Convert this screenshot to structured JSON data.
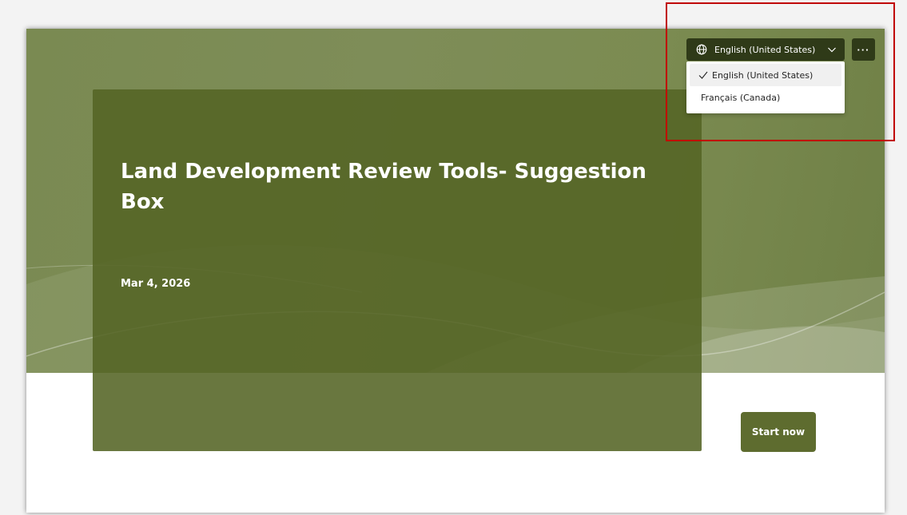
{
  "form": {
    "title": "Land Development Review Tools- Suggestion Box",
    "date": "Mar 4, 2026",
    "start_label": "Start now"
  },
  "language": {
    "current": "English (United States)",
    "options": [
      {
        "label": "English (United States)",
        "selected": true
      },
      {
        "label": "Français (Canada)",
        "selected": false
      }
    ]
  },
  "more": {
    "label": "···"
  },
  "icons": {
    "language": "globe-icon",
    "dropdown": "chevron-down-icon",
    "selected": "checkmark-icon",
    "more": "more-options-icon"
  },
  "colors": {
    "hero": "#7b8b51",
    "panel": "#546424",
    "button": "#5e6c2f",
    "toolbar": "#2f3a18",
    "highlight": "#c00000"
  }
}
